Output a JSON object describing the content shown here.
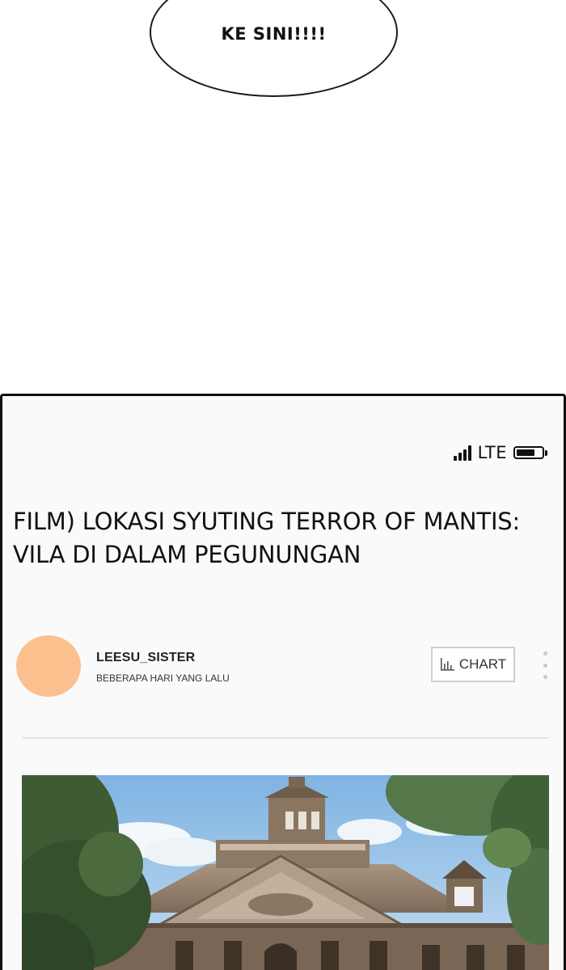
{
  "speech_bubble": {
    "text": "KE SINI!!!!"
  },
  "status_bar": {
    "network": "LTE",
    "battery_level": 0.72
  },
  "post": {
    "title": "FILM) LOKASI SYUTING TERROR OF MANTIS: VILA DI DALAM PEGUNUNGAN",
    "author": "LEESU_SISTER",
    "time": "BEBERAPA HARI YANG LALU",
    "chart_label": "CHART"
  },
  "colors": {
    "avatar": "#fcc08e",
    "frame": "#111111",
    "divider": "#e2e2e2"
  }
}
